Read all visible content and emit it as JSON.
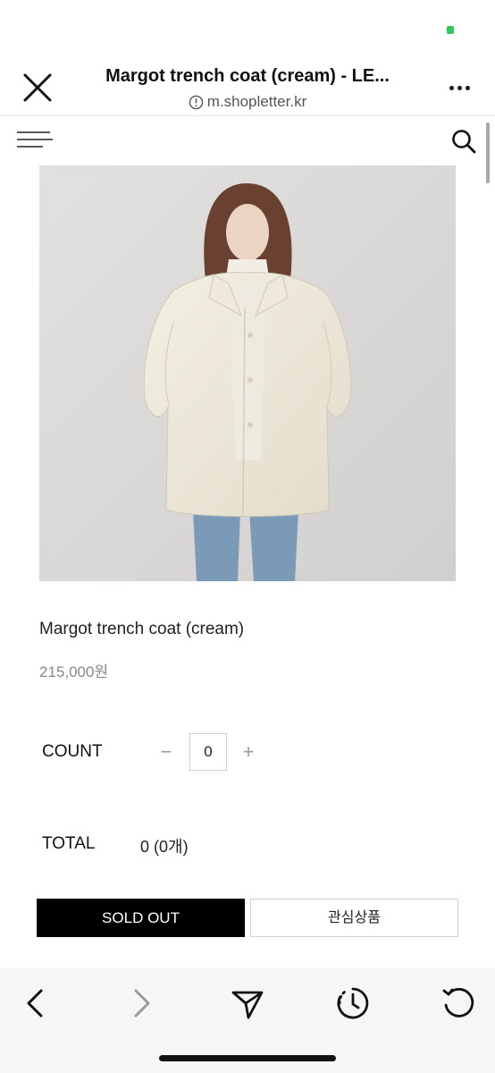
{
  "browser": {
    "page_title": "Margot trench coat (cream) - LE...",
    "url": "m.shopletter.kr"
  },
  "product": {
    "name": "Margot trench coat (cream)",
    "price": "215,000원"
  },
  "quantity": {
    "label": "COUNT",
    "minus": "−",
    "value": "0",
    "plus": "+"
  },
  "total": {
    "label": "TOTAL",
    "value": "0 (0개)"
  },
  "actions": {
    "sold_out": "SOLD OUT",
    "wishlist": "관심상품"
  },
  "toolbar": {
    "icons": [
      "back-icon",
      "forward-icon",
      "share-icon",
      "history-icon",
      "reload-icon"
    ]
  },
  "colors": {
    "status_indicator": "#34c759",
    "sold_out_bg": "#000000",
    "toolbar_bg": "#f6f6f6"
  }
}
